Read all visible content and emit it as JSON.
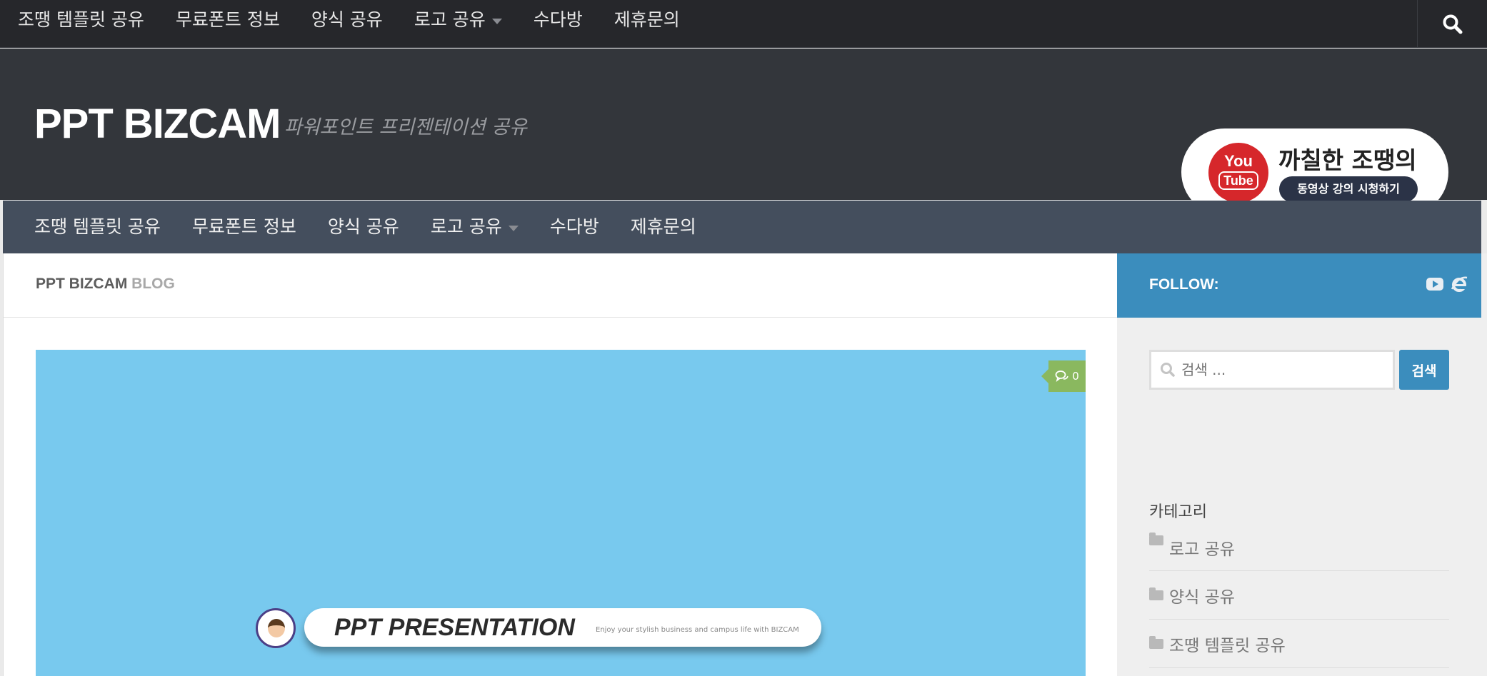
{
  "topnav": {
    "items": [
      "조땡 템플릿 공유",
      "무료폰트 정보",
      "양식 공유",
      "로고 공유",
      "수다방",
      "제휴문의"
    ]
  },
  "header": {
    "site_title": "PPT BIZCAM",
    "tagline": "파워포인트 프리젠테이션 공유",
    "banner": {
      "you": "You",
      "tube": "Tube",
      "title": "까칠한 조땡의",
      "subtitle": "동영상 강의 시청하기"
    }
  },
  "mainnav": {
    "items": [
      "조땡 템플릿 공유",
      "무료폰트 정보",
      "양식 공유",
      "로고 공유",
      "수다방",
      "제휴문의"
    ]
  },
  "page_head": {
    "strong": "PPT BIZCAM",
    "light": "BLOG"
  },
  "post": {
    "comment_count": "0",
    "image_title": "PPT PRESENTATION",
    "image_subtitle": "Enjoy your stylish business and campus life with BIZCAM"
  },
  "sidebar": {
    "follow_label": "FOLLOW:",
    "search_placeholder": "검색 ...",
    "search_button": "검색",
    "categories_title": "카테고리",
    "categories": [
      "로고 공유",
      "양식 공유",
      "조땡 템플릿 공유"
    ]
  },
  "colors": {
    "topbar": "#26272b",
    "header": "#33363b",
    "mainnav": "#444e5d",
    "accent_blue": "#3b8dbd",
    "comment_green": "#8ab85f",
    "featured_bg": "#78c9ee"
  },
  "icons": [
    "search-icon",
    "caret-down-icon",
    "comment-icon",
    "youtube-icon",
    "ie-icon",
    "folder-icon"
  ]
}
